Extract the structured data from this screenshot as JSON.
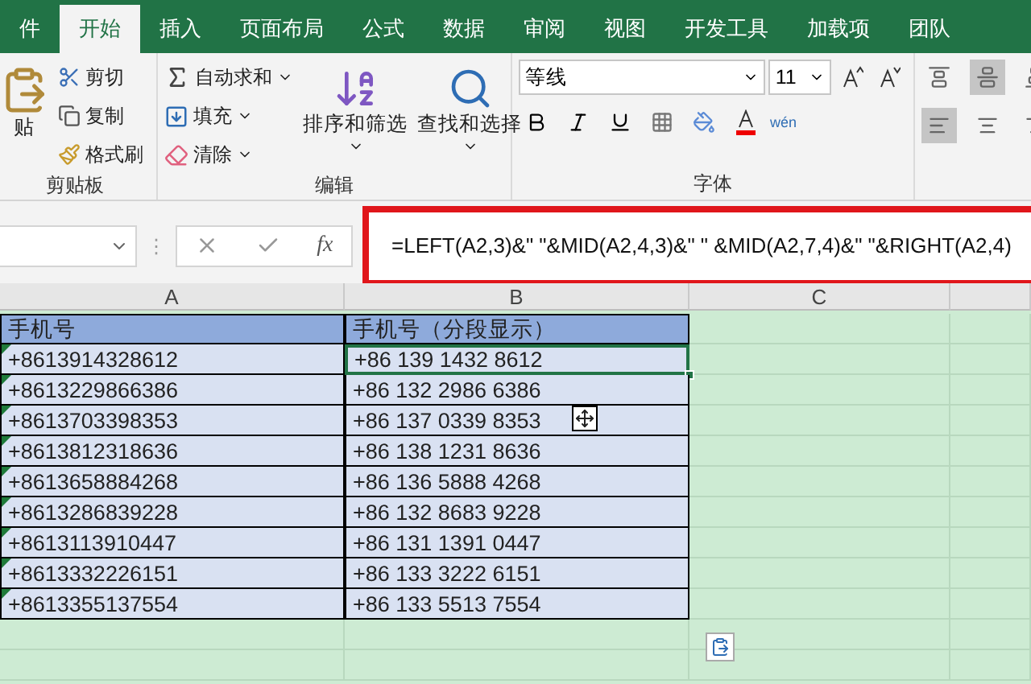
{
  "ribbon_tabs": [
    {
      "label": "件",
      "selected": false
    },
    {
      "label": "开始",
      "selected": true
    },
    {
      "label": "插入",
      "selected": false
    },
    {
      "label": "页面布局",
      "selected": false
    },
    {
      "label": "公式",
      "selected": false
    },
    {
      "label": "数据",
      "selected": false
    },
    {
      "label": "审阅",
      "selected": false
    },
    {
      "label": "视图",
      "selected": false
    },
    {
      "label": "开发工具",
      "selected": false
    },
    {
      "label": "加载项",
      "selected": false
    },
    {
      "label": "团队",
      "selected": false
    }
  ],
  "clipboard": {
    "paste": "贴",
    "cut": "剪切",
    "copy": "复制",
    "format_painter": "格式刷",
    "label": "剪贴板"
  },
  "editing": {
    "autosum": "自动求和",
    "fill": "填充",
    "clear": "清除",
    "sort_filter": "排序和筛选",
    "find_select": "查找和选择",
    "label": "编辑"
  },
  "font": {
    "name": "等线",
    "size": "11",
    "phonetic": "wén",
    "label": "字体"
  },
  "alignment": [
    {
      "kind": "top",
      "selected": false
    },
    {
      "kind": "middle",
      "selected": true
    },
    {
      "kind": "bottom",
      "selected": false
    },
    {
      "kind": "left",
      "selected": true
    },
    {
      "kind": "center",
      "selected": false
    },
    {
      "kind": "right",
      "selected": false
    }
  ],
  "formula_bar": {
    "grip": "⋮",
    "fx": "fx",
    "formula": "=LEFT(A2,3)&\" \"&MID(A2,4,3)&\" \" &MID(A2,7,4)&\" \"&RIGHT(A2,4)",
    "highlighted": true
  },
  "columns": [
    "A",
    "B",
    "C"
  ],
  "table": {
    "header": [
      "手机号",
      "手机号（分段显示）"
    ],
    "rows": [
      {
        "a": "+8613914328612",
        "b": "+86 139 1432 8612",
        "flagged": true,
        "selected": true
      },
      {
        "a": "+8613229866386",
        "b": "+86 132 2986 6386",
        "flagged": true,
        "selected": false
      },
      {
        "a": "+8613703398353",
        "b": "+86 137 0339 8353",
        "flagged": true,
        "selected": false
      },
      {
        "a": "+8613812318636",
        "b": "+86 138 1231 8636",
        "flagged": true,
        "selected": false
      },
      {
        "a": "+8613658884268",
        "b": "+86 136 5888 4268",
        "flagged": true,
        "selected": false
      },
      {
        "a": "+8613286839228",
        "b": "+86 132 8683 9228",
        "flagged": true,
        "selected": false
      },
      {
        "a": "+8613113910447",
        "b": "+86 131 1391 0447",
        "flagged": true,
        "selected": false
      },
      {
        "a": "+8613332226151",
        "b": "+86 133 3222 6151",
        "flagged": true,
        "selected": false
      },
      {
        "a": "+8613355137554",
        "b": "+86 133 5513 7554",
        "flagged": true,
        "selected": false
      }
    ]
  }
}
